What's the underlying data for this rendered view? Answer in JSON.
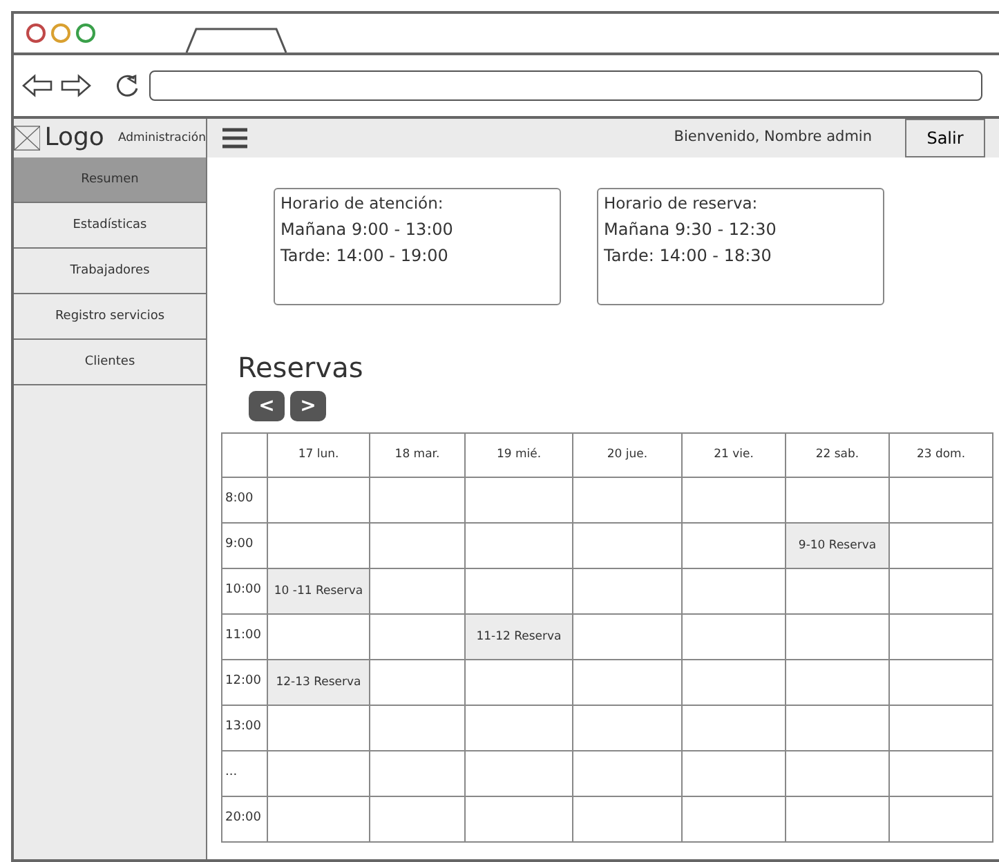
{
  "header": {
    "logo": "Logo",
    "app_name": "Administración",
    "welcome": "Bienvenido, Nombre admin",
    "logout": "Salir"
  },
  "sidebar": {
    "items": [
      {
        "label": "Resumen",
        "selected": true
      },
      {
        "label": "Estadísticas",
        "selected": false
      },
      {
        "label": "Trabajadores",
        "selected": false
      },
      {
        "label": "Registro servicios",
        "selected": false
      },
      {
        "label": "Clientes",
        "selected": false
      }
    ]
  },
  "info_boxes": [
    {
      "title": "Horario de atención:",
      "lines": [
        "Mañana 9:00 - 13:00",
        "Tarde: 14:00 - 19:00"
      ]
    },
    {
      "title": "Horario de reserva:",
      "lines": [
        "Mañana 9:30 - 12:30",
        "Tarde: 14:00 - 18:30"
      ]
    }
  ],
  "reservations": {
    "title": "Reservas",
    "prev": "<",
    "next": ">",
    "columns": [
      "17 lun.",
      "18 mar.",
      "19 mié.",
      "20 jue.",
      "21 vie.",
      "22 sab.",
      "23 dom."
    ],
    "rows": [
      {
        "time": "8:00",
        "cells": [
          {
            "booked": false
          },
          {
            "booked": false
          },
          {
            "booked": false
          },
          {
            "booked": false
          },
          {
            "booked": false
          },
          {
            "booked": false
          },
          {
            "booked": false
          }
        ]
      },
      {
        "time": "9:00",
        "cells": [
          {
            "booked": false
          },
          {
            "booked": false
          },
          {
            "booked": false
          },
          {
            "booked": false
          },
          {
            "booked": false
          },
          {
            "booked": true,
            "text": "9-10 Reserva"
          },
          {
            "booked": false
          }
        ]
      },
      {
        "time": "10:00",
        "cells": [
          {
            "booked": true,
            "text": "10 -11 Reserva"
          },
          {
            "booked": false
          },
          {
            "booked": false
          },
          {
            "booked": false
          },
          {
            "booked": false
          },
          {
            "booked": false
          },
          {
            "booked": false
          }
        ]
      },
      {
        "time": "11:00",
        "cells": [
          {
            "booked": false
          },
          {
            "booked": false
          },
          {
            "booked": true,
            "text": "11-12 Reserva"
          },
          {
            "booked": false
          },
          {
            "booked": false
          },
          {
            "booked": false
          },
          {
            "booked": false
          }
        ]
      },
      {
        "time": "12:00",
        "cells": [
          {
            "booked": true,
            "text": "12-13 Reserva"
          },
          {
            "booked": false
          },
          {
            "booked": false
          },
          {
            "booked": false
          },
          {
            "booked": false
          },
          {
            "booked": false
          },
          {
            "booked": false
          }
        ]
      },
      {
        "time": "13:00",
        "cells": [
          {
            "booked": false
          },
          {
            "booked": false
          },
          {
            "booked": false
          },
          {
            "booked": false
          },
          {
            "booked": false
          },
          {
            "booked": false
          },
          {
            "booked": false
          }
        ]
      },
      {
        "time": "...",
        "cells": [
          {
            "booked": false
          },
          {
            "booked": false
          },
          {
            "booked": false
          },
          {
            "booked": false
          },
          {
            "booked": false
          },
          {
            "booked": false
          },
          {
            "booked": false
          }
        ]
      },
      {
        "time": "20:00",
        "cells": [
          {
            "booked": false
          },
          {
            "booked": false
          },
          {
            "booked": false
          },
          {
            "booked": false
          },
          {
            "booked": false
          },
          {
            "booked": false
          },
          {
            "booked": false
          }
        ]
      }
    ]
  }
}
